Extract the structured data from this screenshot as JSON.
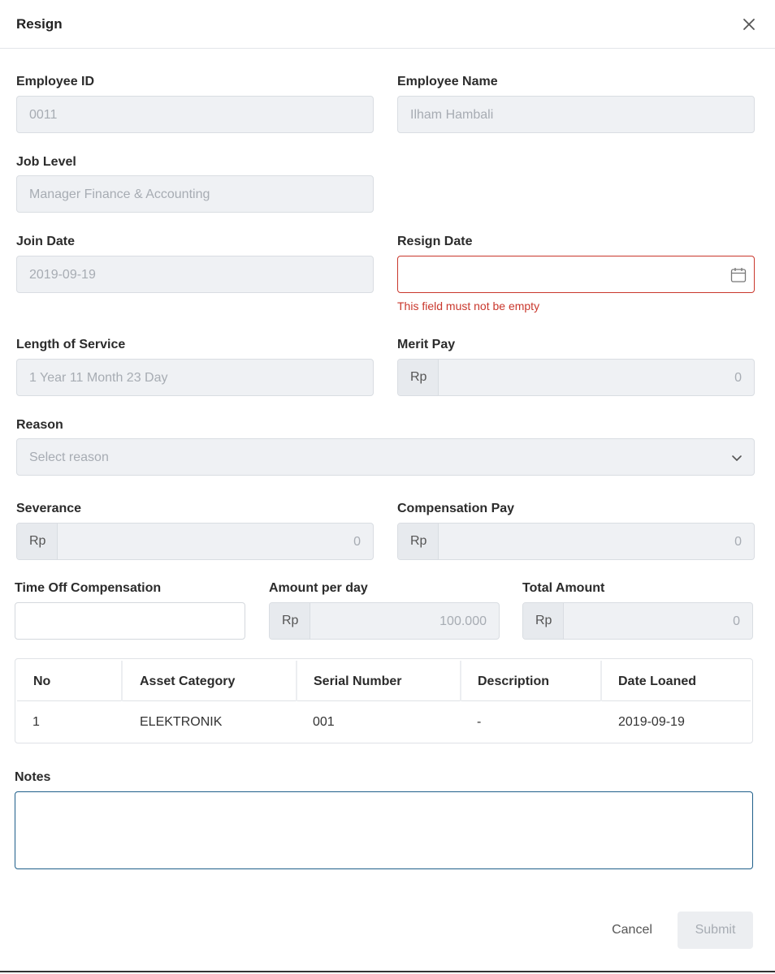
{
  "dialog": {
    "title": "Resign",
    "close_icon": "close-icon"
  },
  "form": {
    "employee_id": {
      "label": "Employee ID",
      "value": "0011"
    },
    "employee_name": {
      "label": "Employee Name",
      "value": "Ilham Hambali"
    },
    "job_level": {
      "label": "Job Level",
      "value": "Manager Finance & Accounting"
    },
    "join_date": {
      "label": "Join Date",
      "value": "2019-09-19"
    },
    "resign_date": {
      "label": "Resign Date",
      "value": "",
      "icon": "calendar-icon",
      "error": "This field must not be empty"
    },
    "length_of_service": {
      "label": "Length of Service",
      "value": "1 Year 11 Month 23 Day"
    },
    "merit_pay": {
      "label": "Merit Pay",
      "prefix": "Rp",
      "value": "0"
    },
    "reason": {
      "label": "Reason",
      "placeholder": "Select reason",
      "icon": "chevron-down-icon"
    },
    "severance": {
      "label": "Severance",
      "prefix": "Rp",
      "value": "0"
    },
    "compensation_pay": {
      "label": "Compensation Pay",
      "prefix": "Rp",
      "value": "0"
    },
    "time_off_compensation": {
      "label": "Time Off Compensation",
      "value": ""
    },
    "amount_per_day": {
      "label": "Amount per day",
      "prefix": "Rp",
      "value": "100.000"
    },
    "total_amount": {
      "label": "Total Amount",
      "prefix": "Rp",
      "value": "0"
    },
    "notes": {
      "label": "Notes",
      "value": ""
    }
  },
  "asset_table": {
    "columns": [
      "No",
      "Asset Category",
      "Serial Number",
      "Description",
      "Date Loaned"
    ],
    "rows": [
      [
        "1",
        "ELEKTRONIK",
        "001",
        "-",
        "2019-09-19"
      ]
    ]
  },
  "footer": {
    "cancel_label": "Cancel",
    "submit_label": "Submit"
  },
  "colors": {
    "error": "#c9372c",
    "focus_border": "#1f5f8a",
    "readonly_bg": "#eff1f4"
  }
}
